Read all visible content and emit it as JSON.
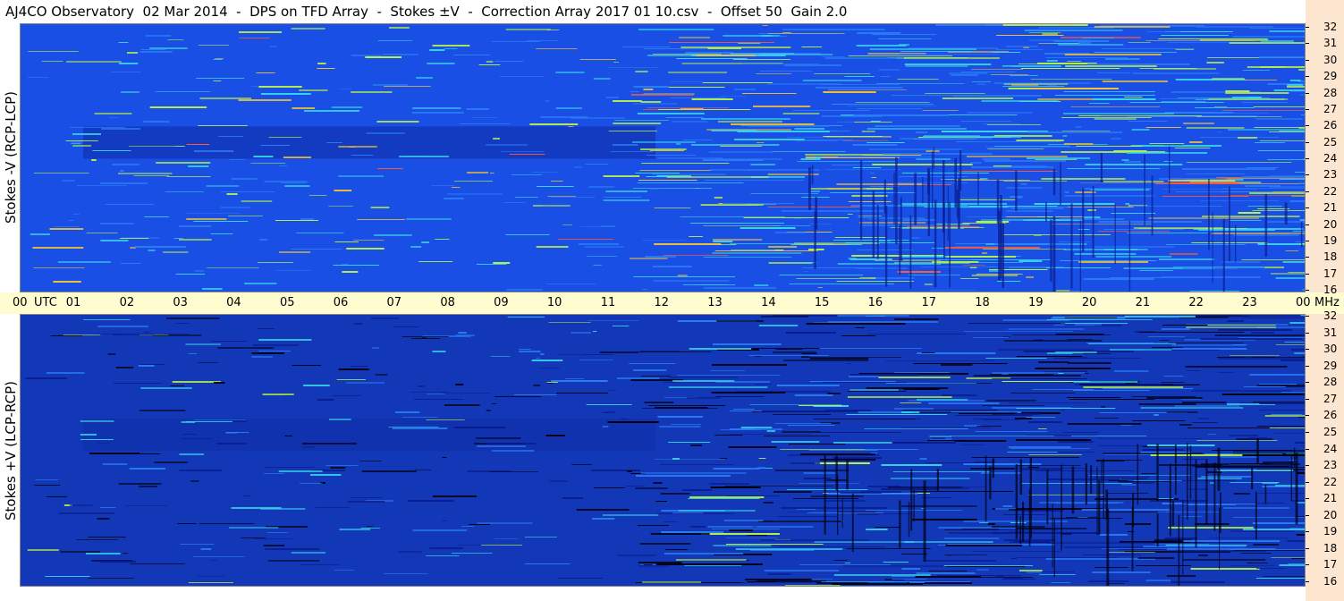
{
  "title": "AJ4CO Observatory  02 Mar 2014  -  DPS on TFD Array  -  Stokes ±V  -  Correction Array 2017 01 10.csv  -  Offset 50  Gain 2.0",
  "chart_data": [
    {
      "type": "heatmap",
      "ylabel": "Stokes -V (RCP-LCP)",
      "xlabel": "UTC",
      "x_ticks": [
        "00",
        "01",
        "02",
        "03",
        "04",
        "05",
        "06",
        "07",
        "08",
        "09",
        "10",
        "11",
        "12",
        "13",
        "14",
        "15",
        "16",
        "17",
        "18",
        "19",
        "20",
        "21",
        "22",
        "23",
        "00"
      ],
      "y_ticks": [
        "32",
        "31",
        "30",
        "29",
        "28",
        "27",
        "26",
        "25",
        "24",
        "23",
        "22",
        "21",
        "20",
        "19",
        "18",
        "17",
        "16"
      ],
      "y_unit": "MHz",
      "xlim": [
        0,
        24
      ],
      "ylim": [
        16,
        32
      ],
      "colormap": [
        "#0a1c8c",
        "#1a4fe6",
        "#2a7cf5",
        "#39d4ea",
        "#b6f04a",
        "#f2c23a",
        "#ff5a3a"
      ]
    },
    {
      "type": "heatmap",
      "ylabel": "Stokes +V (LCP-RCP)",
      "xlabel": "UTC",
      "x_ticks": [
        "00",
        "01",
        "02",
        "03",
        "04",
        "05",
        "06",
        "07",
        "08",
        "09",
        "10",
        "11",
        "12",
        "13",
        "14",
        "15",
        "16",
        "17",
        "18",
        "19",
        "20",
        "21",
        "22",
        "23",
        "00"
      ],
      "y_ticks": [
        "32",
        "31",
        "30",
        "29",
        "28",
        "27",
        "26",
        "25",
        "24",
        "23",
        "22",
        "21",
        "20",
        "19",
        "18",
        "17",
        "16"
      ],
      "y_unit": "MHz",
      "xlim": [
        0,
        24
      ],
      "ylim": [
        16,
        32
      ],
      "colormap": [
        "#000010",
        "#0a1c8c",
        "#1a4fe6",
        "#2a7cf5",
        "#39d4ea",
        "#b6f04a"
      ]
    }
  ],
  "utc_label": "UTC",
  "mhz_label": "MHz"
}
